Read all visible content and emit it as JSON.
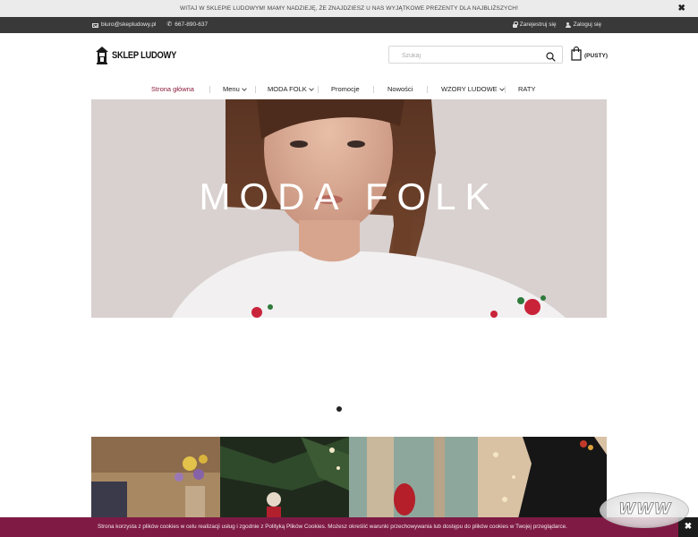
{
  "announcement": {
    "text": "WITAJ W SKLEPIE LUDOWYM! MAMY NADZIEJĘ, ŻE ZNAJDZIESZ U NAS WYJĄTKOWE PREZENTY DLA NAJBLIŻSZYCH!",
    "close": "✖"
  },
  "contact": {
    "email": "biuro@skepludowy.pl",
    "phone": "667-890-637",
    "register": "Zarejestruj się",
    "login": "Zaloguj się"
  },
  "header": {
    "logo_text": "SKLEP LUDOWY",
    "search_placeholder": "Szukaj",
    "cart_label": "(PUSTY)"
  },
  "nav": [
    {
      "label": "Strona główna",
      "active": true,
      "dropdown": false
    },
    {
      "label": "Menu",
      "active": false,
      "dropdown": true
    },
    {
      "label": "MODA FOLK",
      "active": false,
      "dropdown": true
    },
    {
      "label": "Promocje",
      "active": false,
      "dropdown": false
    },
    {
      "label": "Nowości",
      "active": false,
      "dropdown": false
    },
    {
      "label": "WZORY LUDOWE",
      "active": false,
      "dropdown": true
    },
    {
      "label": "RATY",
      "active": false,
      "dropdown": false
    }
  ],
  "hero": {
    "title": "MODA FOLK"
  },
  "cookie": {
    "text": "Strona korzysta z plików cookies w celu realizacji usług i zgodnie z Polityką Plików Cookies. Możesz określić warunki przechowywania lub dostępu do plików cookies w Twojej przeglądarce.",
    "close": "✖"
  },
  "badge": {
    "text": "WWW"
  },
  "colors": {
    "accent": "#7f1a44",
    "active_link": "#8c1a3c",
    "topbar": "#393939"
  }
}
